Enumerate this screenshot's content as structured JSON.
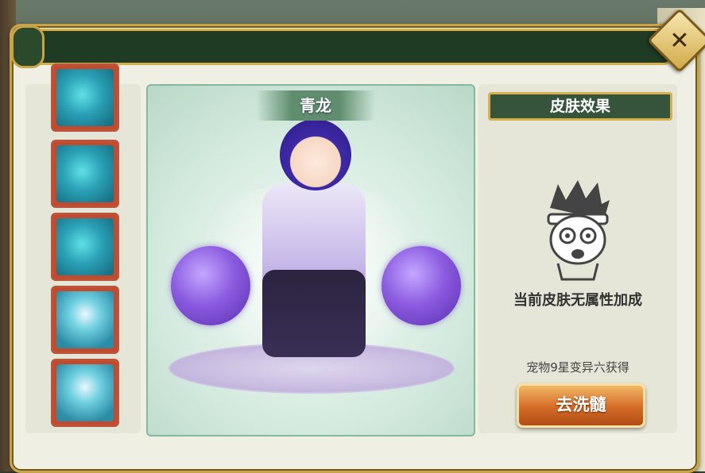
{
  "stage": {
    "name": "青龙",
    "skins": [
      {
        "type": "dragon"
      },
      {
        "type": "dragon"
      },
      {
        "type": "dragon"
      },
      {
        "type": "hero"
      },
      {
        "type": "hero"
      }
    ]
  },
  "info": {
    "title": "皮肤效果",
    "no_bonus": "当前皮肤无属性加成",
    "obtain": "宠物9星变异六获得",
    "button": "去洗髓"
  },
  "icons": {
    "close": "close-icon"
  }
}
